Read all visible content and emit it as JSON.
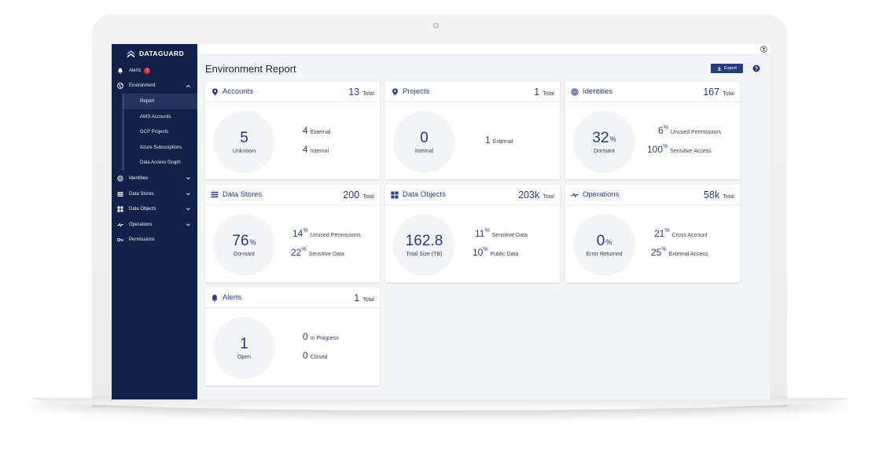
{
  "sidebar": {
    "brand": "DATAGUARD",
    "alerts": {
      "label": "Alerts",
      "badge": "1"
    },
    "environment": {
      "label": "Environment"
    },
    "sub_items": [
      {
        "label": "Report"
      },
      {
        "label": "AWS Accounts"
      },
      {
        "label": "GCP Projects"
      },
      {
        "label": "Azure Subscriptions"
      },
      {
        "label": "Data Access Graph"
      }
    ],
    "items": [
      {
        "label": "Identities"
      },
      {
        "label": "Data Stores"
      },
      {
        "label": "Data Objects"
      },
      {
        "label": "Operations"
      },
      {
        "label": "Permissions"
      }
    ]
  },
  "header": {
    "title": "Environment Report",
    "export_label": "Export"
  },
  "cards": {
    "accounts": {
      "title": "Accounts",
      "total": "13",
      "total_label": "Total",
      "main": "5",
      "caption": "Unknown",
      "stats": [
        {
          "value": "4",
          "label": "External"
        },
        {
          "value": "4",
          "label": "Internal"
        }
      ]
    },
    "projects": {
      "title": "Projects",
      "total": "1",
      "total_label": "Total",
      "main": "0",
      "caption": "Internal",
      "stats": [
        {
          "value": "1",
          "label": "External"
        }
      ]
    },
    "identities": {
      "title": "Identities",
      "total": "167",
      "total_label": "Total",
      "main": "32",
      "caption": "Dormant",
      "stats": [
        {
          "value": "6",
          "label": "Unused Permissions"
        },
        {
          "value": "100",
          "label": "Sensitive Access"
        }
      ]
    },
    "data_stores": {
      "title": "Data Stores",
      "total": "200",
      "total_label": "Total",
      "main": "76",
      "caption": "Dormant",
      "stats": [
        {
          "value": "14",
          "label": "Unused Permissions"
        },
        {
          "value": "22",
          "label": "Sensitive Data"
        }
      ]
    },
    "data_objects": {
      "title": "Data Objects",
      "total": "203k",
      "total_label": "Total",
      "main": "162.8",
      "caption": "Total Size (TB)",
      "stats": [
        {
          "value": "11",
          "label": "Sensitive Data"
        },
        {
          "value": "10",
          "label": "Public Data"
        }
      ]
    },
    "operations": {
      "title": "Operations",
      "total": "58k",
      "total_label": "Total",
      "main": "0",
      "caption": "Error Returned",
      "stats": [
        {
          "value": "21",
          "label": "Cross Account"
        },
        {
          "value": "25",
          "label": "External Access"
        }
      ]
    },
    "alerts": {
      "title": "Alerts",
      "total": "1",
      "total_label": "Total",
      "main": "1",
      "caption": "Open",
      "stats": [
        {
          "value": "0",
          "label": "In Progress"
        },
        {
          "value": "0",
          "label": "Closed"
        }
      ]
    }
  },
  "percent_sign": "%",
  "colors": {
    "sidebar": "#14224a",
    "accent": "#27398a",
    "badge": "#d8343c"
  }
}
